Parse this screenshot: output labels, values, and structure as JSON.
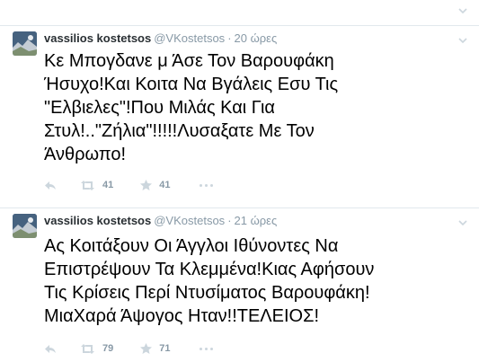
{
  "tweets": [
    {
      "fullname": "vassilios kostetsos",
      "username": "@VKostetsos",
      "time": "20 ώρες",
      "lines": [
        "Κε Μπογδανε μ Άσε Τον Βαρουφάκη",
        "Ήσυχο!Και Κοιτα Να Βγάλεις Εσυ Τις",
        "\"Ελβιελες\"!Που Μιλάς Και Για",
        "Στυλ!..\"Ζήλια\"!!!!!Λυσαξατε Με Τον",
        "Άνθρωπο!"
      ],
      "retweets": "41",
      "favorites": "41"
    },
    {
      "fullname": "vassilios kostetsos",
      "username": "@VKostetsos",
      "time": "21 ώρες",
      "lines": [
        "Ας Κοιτάξουν Οι Άγγλοι Ιθύνοντες Να",
        "Επιστρέψουν Τα Κλεμμένα!Κιας Αφήσουν",
        "Τις Κρίσεις Περί Ντυσίματος Βαρουφάκη!",
        "ΜιαΧαρά Άψογος Ηταν!!ΤΕΛΕΙΟΣ!"
      ],
      "retweets": "79",
      "favorites": "71"
    }
  ],
  "icons": {
    "reply": "reply-icon",
    "retweet": "retweet-icon",
    "favorite": "star-icon",
    "more": "more-icon",
    "caret": "chevron-down-icon"
  },
  "colors": {
    "muted": "#8899a6",
    "name": "#292f33",
    "border": "#e1e8ed",
    "action_icon": "#ccd6dd"
  }
}
